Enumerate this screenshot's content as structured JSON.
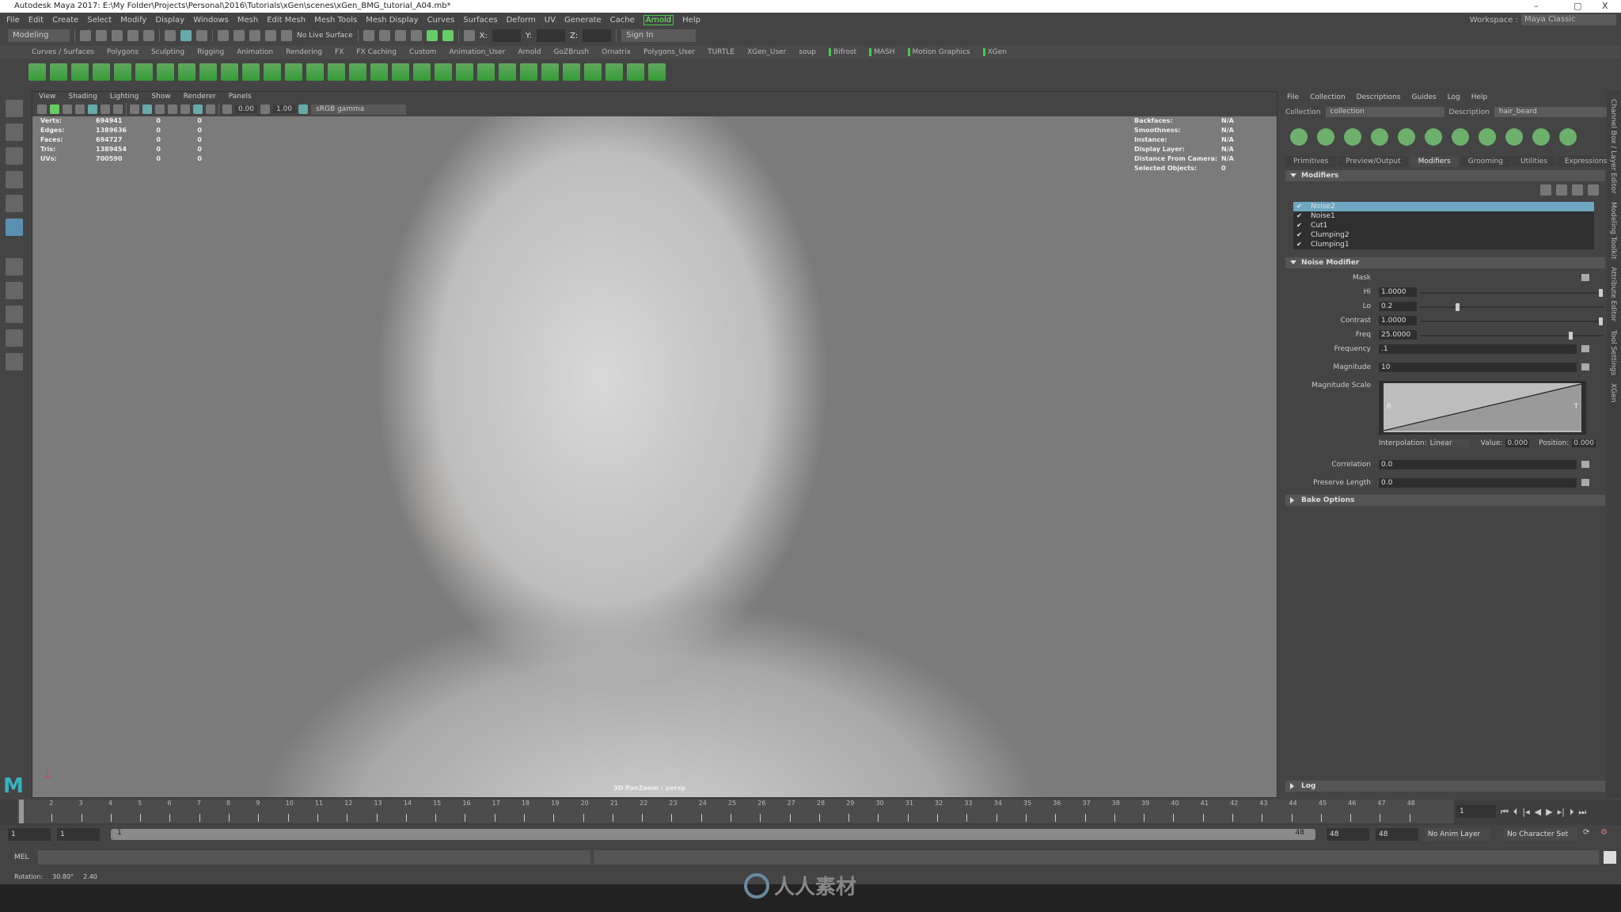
{
  "window": {
    "title": "Autodesk Maya 2017: E:\\My Folder\\Projects\\Personal\\2016\\Tutorials\\xGen\\scenes\\xGen_BMG_tutorial_A04.mb*",
    "minimize": "–",
    "restore": "▢",
    "close": "X"
  },
  "menubar": {
    "items": [
      "File",
      "Edit",
      "Create",
      "Select",
      "Modify",
      "Display",
      "Windows",
      "Mesh",
      "Edit Mesh",
      "Mesh Tools",
      "Mesh Display",
      "Curves",
      "Surfaces",
      "Deform",
      "UV",
      "Generate",
      "Cache",
      "Arnold",
      "Help"
    ],
    "highlighted": "Arnold",
    "workspace_label": "Workspace :",
    "workspace_value": "Maya Classic"
  },
  "status_line": {
    "mode": "Modeling",
    "live_surface": "No Live Surface",
    "x_label": "X:",
    "y_label": "Y:",
    "z_label": "Z:",
    "sign_in": "Sign In"
  },
  "shelf_tabs": [
    "Curves / Surfaces",
    "Polygons",
    "Sculpting",
    "Rigging",
    "Animation",
    "Rendering",
    "FX",
    "FX Caching",
    "Custom",
    "Animation_User",
    "Arnold",
    "GoZBrush",
    "Ornatrix",
    "Polygons_User",
    "TURTLE",
    "XGen_User",
    "soup",
    "Bifrost",
    "MASH",
    "Motion Graphics",
    "XGen"
  ],
  "viewport": {
    "menu": [
      "View",
      "Shading",
      "Lighting",
      "Show",
      "Renderer",
      "Panels"
    ],
    "exposure": "0.00",
    "gamma": "1.00",
    "color_space": "sRGB gamma",
    "hud_left": [
      [
        "Verts:",
        "694941",
        "0",
        "0"
      ],
      [
        "Edges:",
        "1389636",
        "0",
        "0"
      ],
      [
        "Faces:",
        "694727",
        "0",
        "0"
      ],
      [
        "Tris:",
        "1389454",
        "0",
        "0"
      ],
      [
        "UVs:",
        "700590",
        "0",
        "0"
      ]
    ],
    "hud_right": [
      [
        "Backfaces:",
        "N/A"
      ],
      [
        "Smoothness:",
        "N/A"
      ],
      [
        "Instance:",
        "N/A"
      ],
      [
        "Display Layer:",
        "N/A"
      ],
      [
        "Distance From Camera:",
        "N/A"
      ],
      [
        "Selected Objects:",
        "0"
      ]
    ],
    "camera_label": "3D PanZoom : persp"
  },
  "xgen": {
    "menu": [
      "File",
      "Collection",
      "Descriptions",
      "Guides",
      "Log",
      "Help"
    ],
    "collection_label": "Collection",
    "collection_value": "collection",
    "description_label": "Description",
    "description_value": "hair_beard",
    "tabs": [
      "Primitives",
      "Preview/Output",
      "Modifiers",
      "Grooming",
      "Utilities",
      "Expressions"
    ],
    "active_tab": "Modifiers",
    "modifiers_header": "Modifiers",
    "modifiers": [
      "Noise2",
      "Noise1",
      "Cut1",
      "Clumping2",
      "Clumping1"
    ],
    "selected_modifier": "Noise2",
    "noise_header": "Noise Modifier",
    "mask_label": "Mask",
    "sliders": [
      {
        "label": "Hi",
        "value": "1.0000",
        "fraction": 1.0
      },
      {
        "label": "Lo",
        "value": "0.2",
        "fraction": 0.2
      },
      {
        "label": "Contrast",
        "value": "1.0000",
        "fraction": 1.0
      },
      {
        "label": "Freq",
        "value": "25.0000",
        "fraction": 0.83
      }
    ],
    "fields": [
      {
        "label": "Frequency",
        "value": ".1"
      },
      {
        "label": "Magnitude",
        "value": "10"
      }
    ],
    "magnitude_scale": {
      "label": "Magnitude Scale",
      "left": "R",
      "right": "T",
      "interpolation_label": "Interpolation:",
      "interpolation": "Linear",
      "value_label": "Value:",
      "value": "0.000",
      "position_label": "Position:",
      "position": "0.000"
    },
    "fields2": [
      {
        "label": "Correlation",
        "value": "0.0"
      },
      {
        "label": "Preserve Length",
        "value": "0.0"
      }
    ],
    "bake_options": "Bake Options",
    "log": "Log"
  },
  "side_tabs": [
    "Channel Box / Layer Editor",
    "Modeling Toolkit",
    "Attribute Editor",
    "Tool Settings",
    "XGen"
  ],
  "timeline": {
    "start": 1,
    "end": 48,
    "current": "1",
    "range_start": "1",
    "range_inner_start": "1",
    "range_end_label": "48",
    "range_inner_end": "48",
    "playback_end": "48",
    "anim_layer": "No Anim Layer",
    "character_set": "No Character Set"
  },
  "command": {
    "label": "MEL"
  },
  "help_line": {
    "label": "Rotation:",
    "v1": "30.80°",
    "v2": "2.40"
  },
  "watermark": "人人素材"
}
